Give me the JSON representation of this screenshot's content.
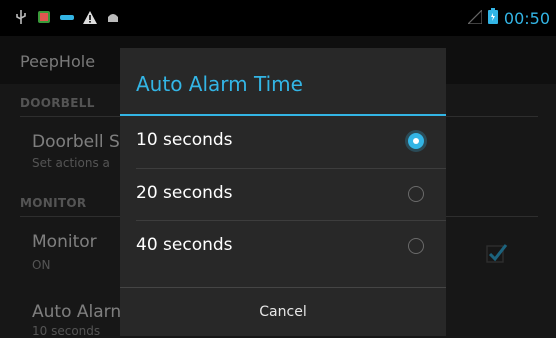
{
  "status": {
    "time": "00:50",
    "accent": "#33b5e5"
  },
  "app": {
    "title": "PeepHole"
  },
  "background": {
    "sections": [
      "DOORBELL",
      "MONITOR"
    ],
    "items": [
      {
        "title": "Doorbell S",
        "summary": "Set actions a"
      },
      {
        "title": "Monitor",
        "summary": "ON"
      },
      {
        "title": "Auto Alarn",
        "summary": "10 seconds"
      }
    ]
  },
  "dialog": {
    "title": "Auto Alarm Time",
    "options": [
      {
        "label": "10 seconds",
        "selected": true
      },
      {
        "label": "20 seconds",
        "selected": false
      },
      {
        "label": "40 seconds",
        "selected": false
      }
    ],
    "cancel": "Cancel"
  }
}
